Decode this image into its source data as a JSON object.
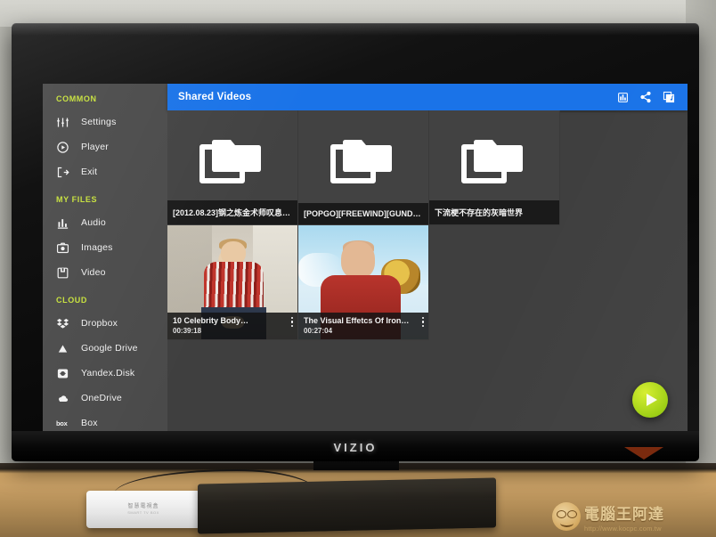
{
  "device": {
    "tv_brand": "VIZIO"
  },
  "app": {
    "appbar": {
      "title": "Shared Videos",
      "icons": [
        {
          "name": "view-mode-icon",
          "glyph": "grid"
        },
        {
          "name": "share-icon",
          "glyph": "share"
        },
        {
          "name": "playlist-icon",
          "glyph": "playlist"
        }
      ]
    },
    "sidebar": {
      "sections": [
        {
          "header": "COMMON",
          "items": [
            {
              "label": "Settings",
              "icon": "sliders-icon"
            },
            {
              "label": "Player",
              "icon": "play-circle-icon"
            },
            {
              "label": "Exit",
              "icon": "exit-icon"
            }
          ]
        },
        {
          "header": "MY FILES",
          "items": [
            {
              "label": "Audio",
              "icon": "equalizer-icon"
            },
            {
              "label": "Images",
              "icon": "photo-icon"
            },
            {
              "label": "Video",
              "icon": "video-icon"
            }
          ]
        },
        {
          "header": "CLOUD",
          "items": [
            {
              "label": "Dropbox",
              "icon": "dropbox-icon"
            },
            {
              "label": "Google Drive",
              "icon": "google-drive-icon"
            },
            {
              "label": "Yandex.Disk",
              "icon": "yandex-disk-icon"
            },
            {
              "label": "OneDrive",
              "icon": "onedrive-icon"
            },
            {
              "label": "Box",
              "icon": "box-icon"
            }
          ]
        }
      ]
    },
    "grid": {
      "tiles": [
        {
          "type": "folder",
          "name": "[2012.08.23]钢之炼金术师叹息之…",
          "duration": "",
          "thumb": ""
        },
        {
          "type": "folder",
          "name": "[POPGO][FREEWIND][GUNDAM…",
          "duration": "",
          "thumb": ""
        },
        {
          "type": "folder",
          "name": "下流梗不存在的灰暗世界",
          "duration": "",
          "thumb": ""
        },
        {
          "type": "video",
          "name": "10 Celebrity Body…",
          "duration": "00:39:18",
          "thumb": "th-celeb"
        },
        {
          "type": "video",
          "name": "The Visual Effetcs Of Iron…",
          "duration": "00:27:04",
          "thumb": "th-iron"
        }
      ]
    },
    "fab": {
      "name": "play-fab",
      "label": "▶"
    },
    "colors": {
      "appbar_blue": "#1a73e8",
      "section_header_green": "#c6e03b",
      "fab_green": "#9ccf10",
      "sidebar_gray": "#4a4a4a",
      "content_gray": "#3f3f3f"
    }
  },
  "watermark": {
    "brand": "電腦王阿達",
    "url": "http://www.kocpc.com.tw"
  }
}
